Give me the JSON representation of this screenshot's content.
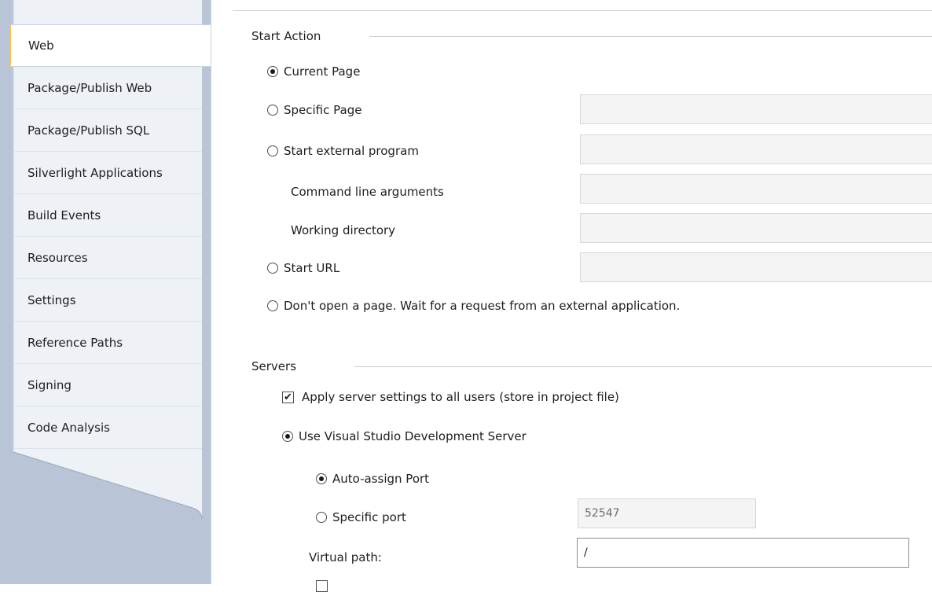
{
  "tabs": [
    {
      "label": "Web",
      "selected": true
    },
    {
      "label": "Package/Publish Web"
    },
    {
      "label": "Package/Publish SQL"
    },
    {
      "label": "Silverlight Applications"
    },
    {
      "label": "Build Events"
    },
    {
      "label": "Resources"
    },
    {
      "label": "Settings"
    },
    {
      "label": "Reference Paths"
    },
    {
      "label": "Signing"
    },
    {
      "label": "Code Analysis"
    }
  ],
  "start_action": {
    "title": "Start Action",
    "current_page": "Current Page",
    "specific_page": "Specific Page",
    "start_external_program": "Start external program",
    "command_line_arguments": "Command line arguments",
    "working_directory": "Working directory",
    "start_url": "Start URL",
    "dont_open": "Don't open a page.  Wait for a request from an external application.",
    "selected": "current_page"
  },
  "servers": {
    "title": "Servers",
    "apply_settings": "Apply server settings to all users (store in project file)",
    "apply_settings_checked": true,
    "use_vs_dev_server": "Use Visual Studio Development Server",
    "auto_assign_port": "Auto-assign Port",
    "specific_port": "Specific port",
    "port_value": "52547",
    "virtual_path_label": "Virtual path:",
    "virtual_path_value": "/",
    "check_glyph": "✔"
  },
  "colors": {
    "selected_tab_accent": "#f2c94c",
    "rail_background": "#b9c5d6"
  }
}
